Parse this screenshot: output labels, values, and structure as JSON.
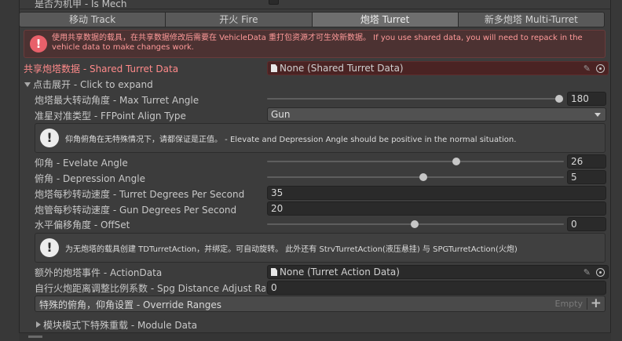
{
  "top_partial_label": "是否为机甲 - Is Mech",
  "tabs": [
    {
      "label": "移动 Track",
      "active": false
    },
    {
      "label": "开火 Fire",
      "active": false
    },
    {
      "label": "炮塔 Turret",
      "active": true
    },
    {
      "label": "新多炮塔 Multi-Turret",
      "active": false
    }
  ],
  "warning": {
    "icon": "error-icon",
    "text": "使用共享数据的载具，在共享数据修改后需要在 VehicleData 重打包资源才可生效新数据。 If you use shared data, you will need to repack in the vehicle data to make changes work."
  },
  "shared_turret": {
    "label": "共享炮塔数据 - Shared Turret Data",
    "value": "None (Shared Turret Data)"
  },
  "foldout_expand": {
    "label": "点击展开 - Click to expand",
    "expanded": true
  },
  "max_turret_angle": {
    "label": "炮塔最大转动角度 - Max Turret Angle",
    "value": "180",
    "fraction": 1.0
  },
  "ffpoint_align": {
    "label": "准星对准类型 - FFPoint Align Type",
    "value": "Gun"
  },
  "info_angle": {
    "icon": "info-icon",
    "text": "仰角俯角在无特殊情况下，请都保证是正值。 - Elevate and Depression Angle should be positive in the normal situation."
  },
  "elevate_angle": {
    "label": "仰角 - Evelate Angle",
    "value": "26",
    "fraction": 0.633
  },
  "depression_angle": {
    "label": "俯角 - Depression Angle",
    "value": "5",
    "fraction": 0.525
  },
  "turret_speed": {
    "label": "炮塔每秒转动速度 - Turret Degrees Per Second",
    "value": "35"
  },
  "gun_speed": {
    "label": "炮管每秒转动速度 - Gun Degrees Per Second",
    "value": "20"
  },
  "offset": {
    "label": "水平偏移角度 - OffSet",
    "value": "0",
    "fraction": 0.5
  },
  "info_action": {
    "icon": "info-icon",
    "text": "为无炮塔的载具创建 TDTurretAction，并绑定。可自动旋转。 此外还有 StrvTurretAction(液压悬挂) 与 SPGTurretAction(火炮)"
  },
  "action_data": {
    "label": "额外的炮塔事件 - ActionData",
    "value": "None (Turret Action Data)"
  },
  "spg_distance": {
    "label": "自行火炮距离调整比例系数 - Spg Distance Adjust Ratio",
    "value": "0"
  },
  "override_ranges": {
    "label": "特殊的俯角，仰角设置 - Override Ranges",
    "empty_text": "Empty",
    "add_symbol": "+"
  },
  "module_data": {
    "label": "模块模式下特殊重载 - Module Data",
    "expanded": false
  }
}
